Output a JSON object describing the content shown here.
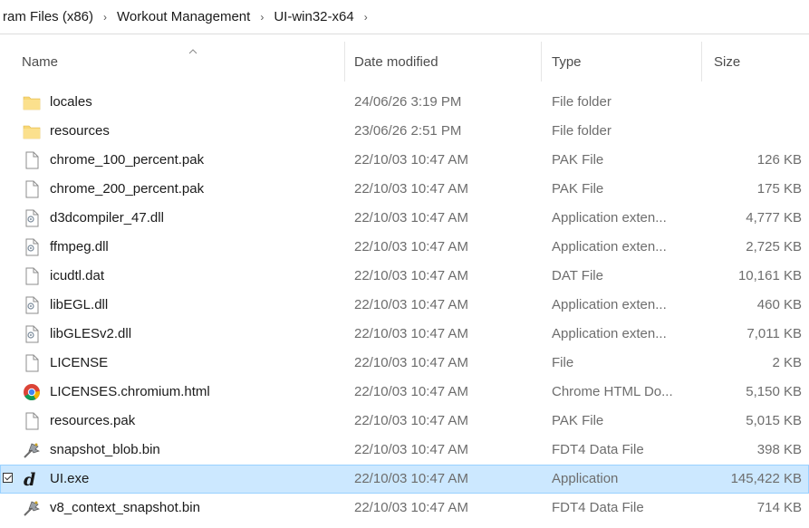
{
  "breadcrumb": {
    "items": [
      "ram Files (x86)",
      "Workout Management",
      "UI-win32-x64"
    ],
    "separator": "›"
  },
  "columns": {
    "name": "Name",
    "date": "Date modified",
    "type": "Type",
    "size": "Size"
  },
  "files": [
    {
      "name": "locales",
      "date": "24/06/26 3:19 PM",
      "type": "File folder",
      "size": "",
      "icon": "folder-icon"
    },
    {
      "name": "resources",
      "date": "23/06/26 2:51 PM",
      "type": "File folder",
      "size": "",
      "icon": "folder-icon"
    },
    {
      "name": "chrome_100_percent.pak",
      "date": "22/10/03 10:47 AM",
      "type": "PAK File",
      "size": "126 KB",
      "icon": "file-icon"
    },
    {
      "name": "chrome_200_percent.pak",
      "date": "22/10/03 10:47 AM",
      "type": "PAK File",
      "size": "175 KB",
      "icon": "file-icon"
    },
    {
      "name": "d3dcompiler_47.dll",
      "date": "22/10/03 10:47 AM",
      "type": "Application exten...",
      "size": "4,777 KB",
      "icon": "dll-icon"
    },
    {
      "name": "ffmpeg.dll",
      "date": "22/10/03 10:47 AM",
      "type": "Application exten...",
      "size": "2,725 KB",
      "icon": "dll-icon"
    },
    {
      "name": "icudtl.dat",
      "date": "22/10/03 10:47 AM",
      "type": "DAT File",
      "size": "10,161 KB",
      "icon": "file-icon"
    },
    {
      "name": "libEGL.dll",
      "date": "22/10/03 10:47 AM",
      "type": "Application exten...",
      "size": "460 KB",
      "icon": "dll-icon"
    },
    {
      "name": "libGLESv2.dll",
      "date": "22/10/03 10:47 AM",
      "type": "Application exten...",
      "size": "7,011 KB",
      "icon": "dll-icon"
    },
    {
      "name": "LICENSE",
      "date": "22/10/03 10:47 AM",
      "type": "File",
      "size": "2 KB",
      "icon": "file-icon"
    },
    {
      "name": "LICENSES.chromium.html",
      "date": "22/10/03 10:47 AM",
      "type": "Chrome HTML Do...",
      "size": "5,150 KB",
      "icon": "chrome-icon"
    },
    {
      "name": "resources.pak",
      "date": "22/10/03 10:47 AM",
      "type": "PAK File",
      "size": "5,015 KB",
      "icon": "file-icon"
    },
    {
      "name": "snapshot_blob.bin",
      "date": "22/10/03 10:47 AM",
      "type": "FDT4 Data File",
      "size": "398 KB",
      "icon": "data-file-icon"
    },
    {
      "name": "UI.exe",
      "date": "22/10/03 10:47 AM",
      "type": "Application",
      "size": "145,422 KB",
      "icon": "app-icon",
      "selected": true
    },
    {
      "name": "v8_context_snapshot.bin",
      "date": "22/10/03 10:47 AM",
      "type": "FDT4 Data File",
      "size": "714 KB",
      "icon": "data-file-icon"
    }
  ],
  "colors": {
    "folder": "#f8d775",
    "selection": "#cce8ff",
    "selection_border": "#99d1ff"
  }
}
